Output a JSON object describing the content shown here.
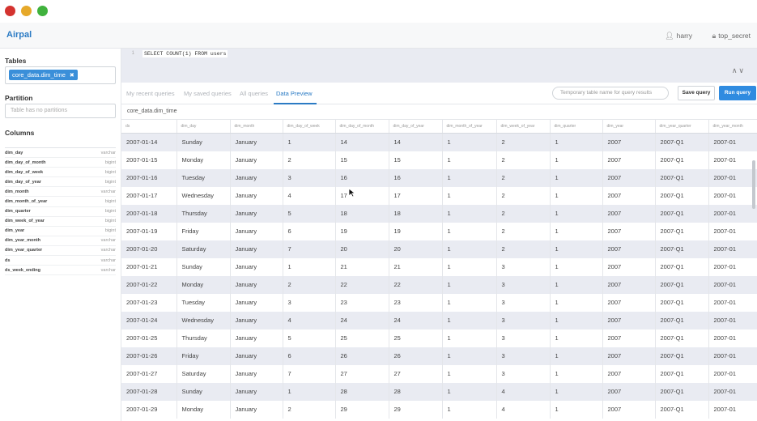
{
  "app": {
    "brand": "Airpal",
    "user": "harry",
    "role": "top_secret"
  },
  "sidebar": {
    "tables_title": "Tables",
    "selected_table": "core_data.dim_time",
    "partition_title": "Partition",
    "partition_placeholder": "Table has no partitions",
    "columns_title": "Columns",
    "columns": [
      {
        "name": "dim_day",
        "type": "varchar"
      },
      {
        "name": "dim_day_of_month",
        "type": "bigint"
      },
      {
        "name": "dim_day_of_week",
        "type": "bigint"
      },
      {
        "name": "dim_day_of_year",
        "type": "bigint"
      },
      {
        "name": "dim_month",
        "type": "varchar"
      },
      {
        "name": "dim_month_of_year",
        "type": "bigint"
      },
      {
        "name": "dim_quarter",
        "type": "bigint"
      },
      {
        "name": "dim_week_of_year",
        "type": "bigint"
      },
      {
        "name": "dim_year",
        "type": "bigint"
      },
      {
        "name": "dim_year_month",
        "type": "varchar"
      },
      {
        "name": "dim_year_quarter",
        "type": "varchar"
      },
      {
        "name": "ds",
        "type": "varchar"
      },
      {
        "name": "ds_week_ending",
        "type": "varchar"
      }
    ]
  },
  "editor": {
    "line_number": "1",
    "query": "SELECT COUNT(1) FROM users",
    "arrows": "∧∨"
  },
  "tabs": {
    "recent": "My recent queries",
    "saved": "My saved queries",
    "all": "All queries",
    "preview": "Data Preview",
    "temp_placeholder": "Temporary table name for query results",
    "save_label": "Save query",
    "run_label": "Run query"
  },
  "table": {
    "title": "core_data.dim_time",
    "headers": [
      "ds",
      "dim_day",
      "dim_month",
      "dim_day_of_week",
      "dim_day_of_month",
      "dim_day_of_year",
      "dim_month_of_year",
      "dim_week_of_year",
      "dim_quarter",
      "dim_year",
      "dim_year_quarter",
      "dim_year_month"
    ],
    "rows": [
      [
        "2007-01-14",
        "Sunday",
        "January",
        "1",
        "14",
        "14",
        "1",
        "2",
        "1",
        "2007",
        "2007-Q1",
        "2007-01"
      ],
      [
        "2007-01-15",
        "Monday",
        "January",
        "2",
        "15",
        "15",
        "1",
        "2",
        "1",
        "2007",
        "2007-Q1",
        "2007-01"
      ],
      [
        "2007-01-16",
        "Tuesday",
        "January",
        "3",
        "16",
        "16",
        "1",
        "2",
        "1",
        "2007",
        "2007-Q1",
        "2007-01"
      ],
      [
        "2007-01-17",
        "Wednesday",
        "January",
        "4",
        "17",
        "17",
        "1",
        "2",
        "1",
        "2007",
        "2007-Q1",
        "2007-01"
      ],
      [
        "2007-01-18",
        "Thursday",
        "January",
        "5",
        "18",
        "18",
        "1",
        "2",
        "1",
        "2007",
        "2007-Q1",
        "2007-01"
      ],
      [
        "2007-01-19",
        "Friday",
        "January",
        "6",
        "19",
        "19",
        "1",
        "2",
        "1",
        "2007",
        "2007-Q1",
        "2007-01"
      ],
      [
        "2007-01-20",
        "Saturday",
        "January",
        "7",
        "20",
        "20",
        "1",
        "2",
        "1",
        "2007",
        "2007-Q1",
        "2007-01"
      ],
      [
        "2007-01-21",
        "Sunday",
        "January",
        "1",
        "21",
        "21",
        "1",
        "3",
        "1",
        "2007",
        "2007-Q1",
        "2007-01"
      ],
      [
        "2007-01-22",
        "Monday",
        "January",
        "2",
        "22",
        "22",
        "1",
        "3",
        "1",
        "2007",
        "2007-Q1",
        "2007-01"
      ],
      [
        "2007-01-23",
        "Tuesday",
        "January",
        "3",
        "23",
        "23",
        "1",
        "3",
        "1",
        "2007",
        "2007-Q1",
        "2007-01"
      ],
      [
        "2007-01-24",
        "Wednesday",
        "January",
        "4",
        "24",
        "24",
        "1",
        "3",
        "1",
        "2007",
        "2007-Q1",
        "2007-01"
      ],
      [
        "2007-01-25",
        "Thursday",
        "January",
        "5",
        "25",
        "25",
        "1",
        "3",
        "1",
        "2007",
        "2007-Q1",
        "2007-01"
      ],
      [
        "2007-01-26",
        "Friday",
        "January",
        "6",
        "26",
        "26",
        "1",
        "3",
        "1",
        "2007",
        "2007-Q1",
        "2007-01"
      ],
      [
        "2007-01-27",
        "Saturday",
        "January",
        "7",
        "27",
        "27",
        "1",
        "3",
        "1",
        "2007",
        "2007-Q1",
        "2007-01"
      ],
      [
        "2007-01-28",
        "Sunday",
        "January",
        "1",
        "28",
        "28",
        "1",
        "4",
        "1",
        "2007",
        "2007-Q1",
        "2007-01"
      ],
      [
        "2007-01-29",
        "Monday",
        "January",
        "2",
        "29",
        "29",
        "1",
        "4",
        "1",
        "2007",
        "2007-Q1",
        "2007-01"
      ]
    ]
  },
  "colors": {
    "accent": "#2b7bc4",
    "run_button": "#2f8be0",
    "chip": "#3a8fd9",
    "alt_row": "#e9ebf2"
  }
}
